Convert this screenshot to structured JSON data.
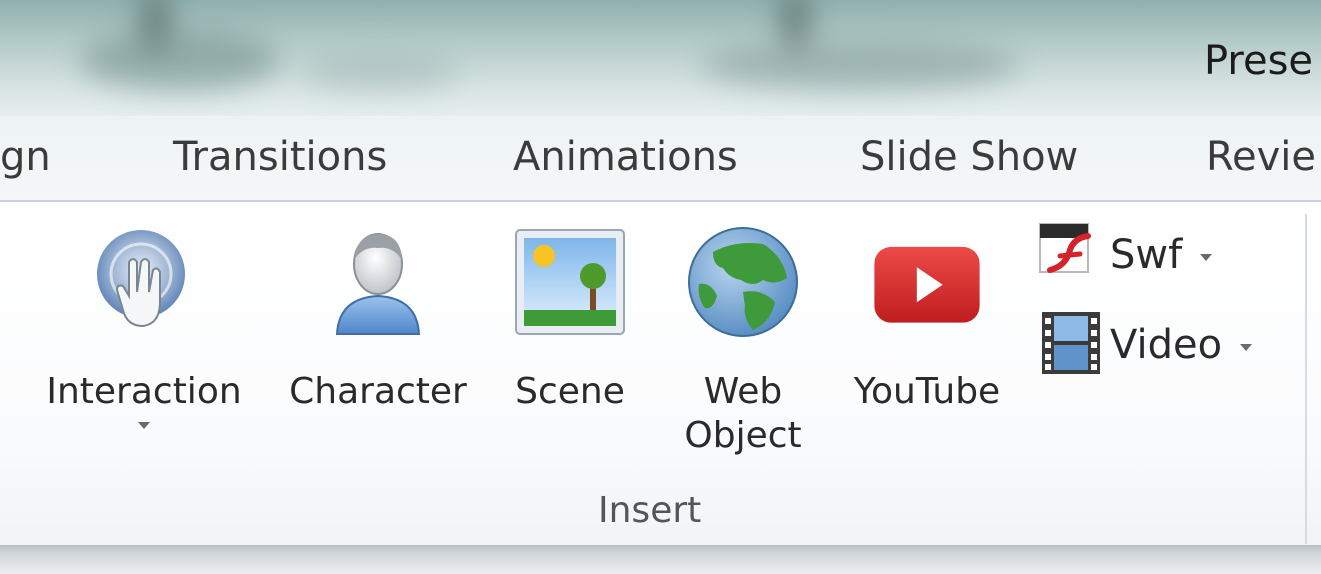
{
  "window": {
    "title": "Prese"
  },
  "tabs": [
    {
      "label": "gn"
    },
    {
      "label": "Transitions"
    },
    {
      "label": "Animations"
    },
    {
      "label": "Slide Show"
    },
    {
      "label": "Revie"
    }
  ],
  "ribbon": {
    "group_label": "Insert",
    "big_buttons": [
      {
        "label": "Interaction",
        "icon": "hand-touch-icon",
        "has_dropdown": true
      },
      {
        "label": "Character",
        "icon": "person-icon"
      },
      {
        "label": "Scene",
        "icon": "landscape-icon"
      },
      {
        "label_line1": "Web",
        "label_line2": "Object",
        "icon": "globe-icon"
      },
      {
        "label": "YouTube",
        "icon": "youtube-icon"
      }
    ],
    "small_buttons": [
      {
        "label": "Swf",
        "icon": "flash-icon",
        "has_dropdown": true
      },
      {
        "label": "Video",
        "icon": "film-strip-icon",
        "has_dropdown": true
      }
    ]
  },
  "colors": {
    "youtube_red": "#d8272a",
    "globe_green": "#3e9a3a",
    "globe_blue": "#6f9fcf",
    "person_blue": "#6d9fd6",
    "hand_blue": "#5f84b8"
  }
}
